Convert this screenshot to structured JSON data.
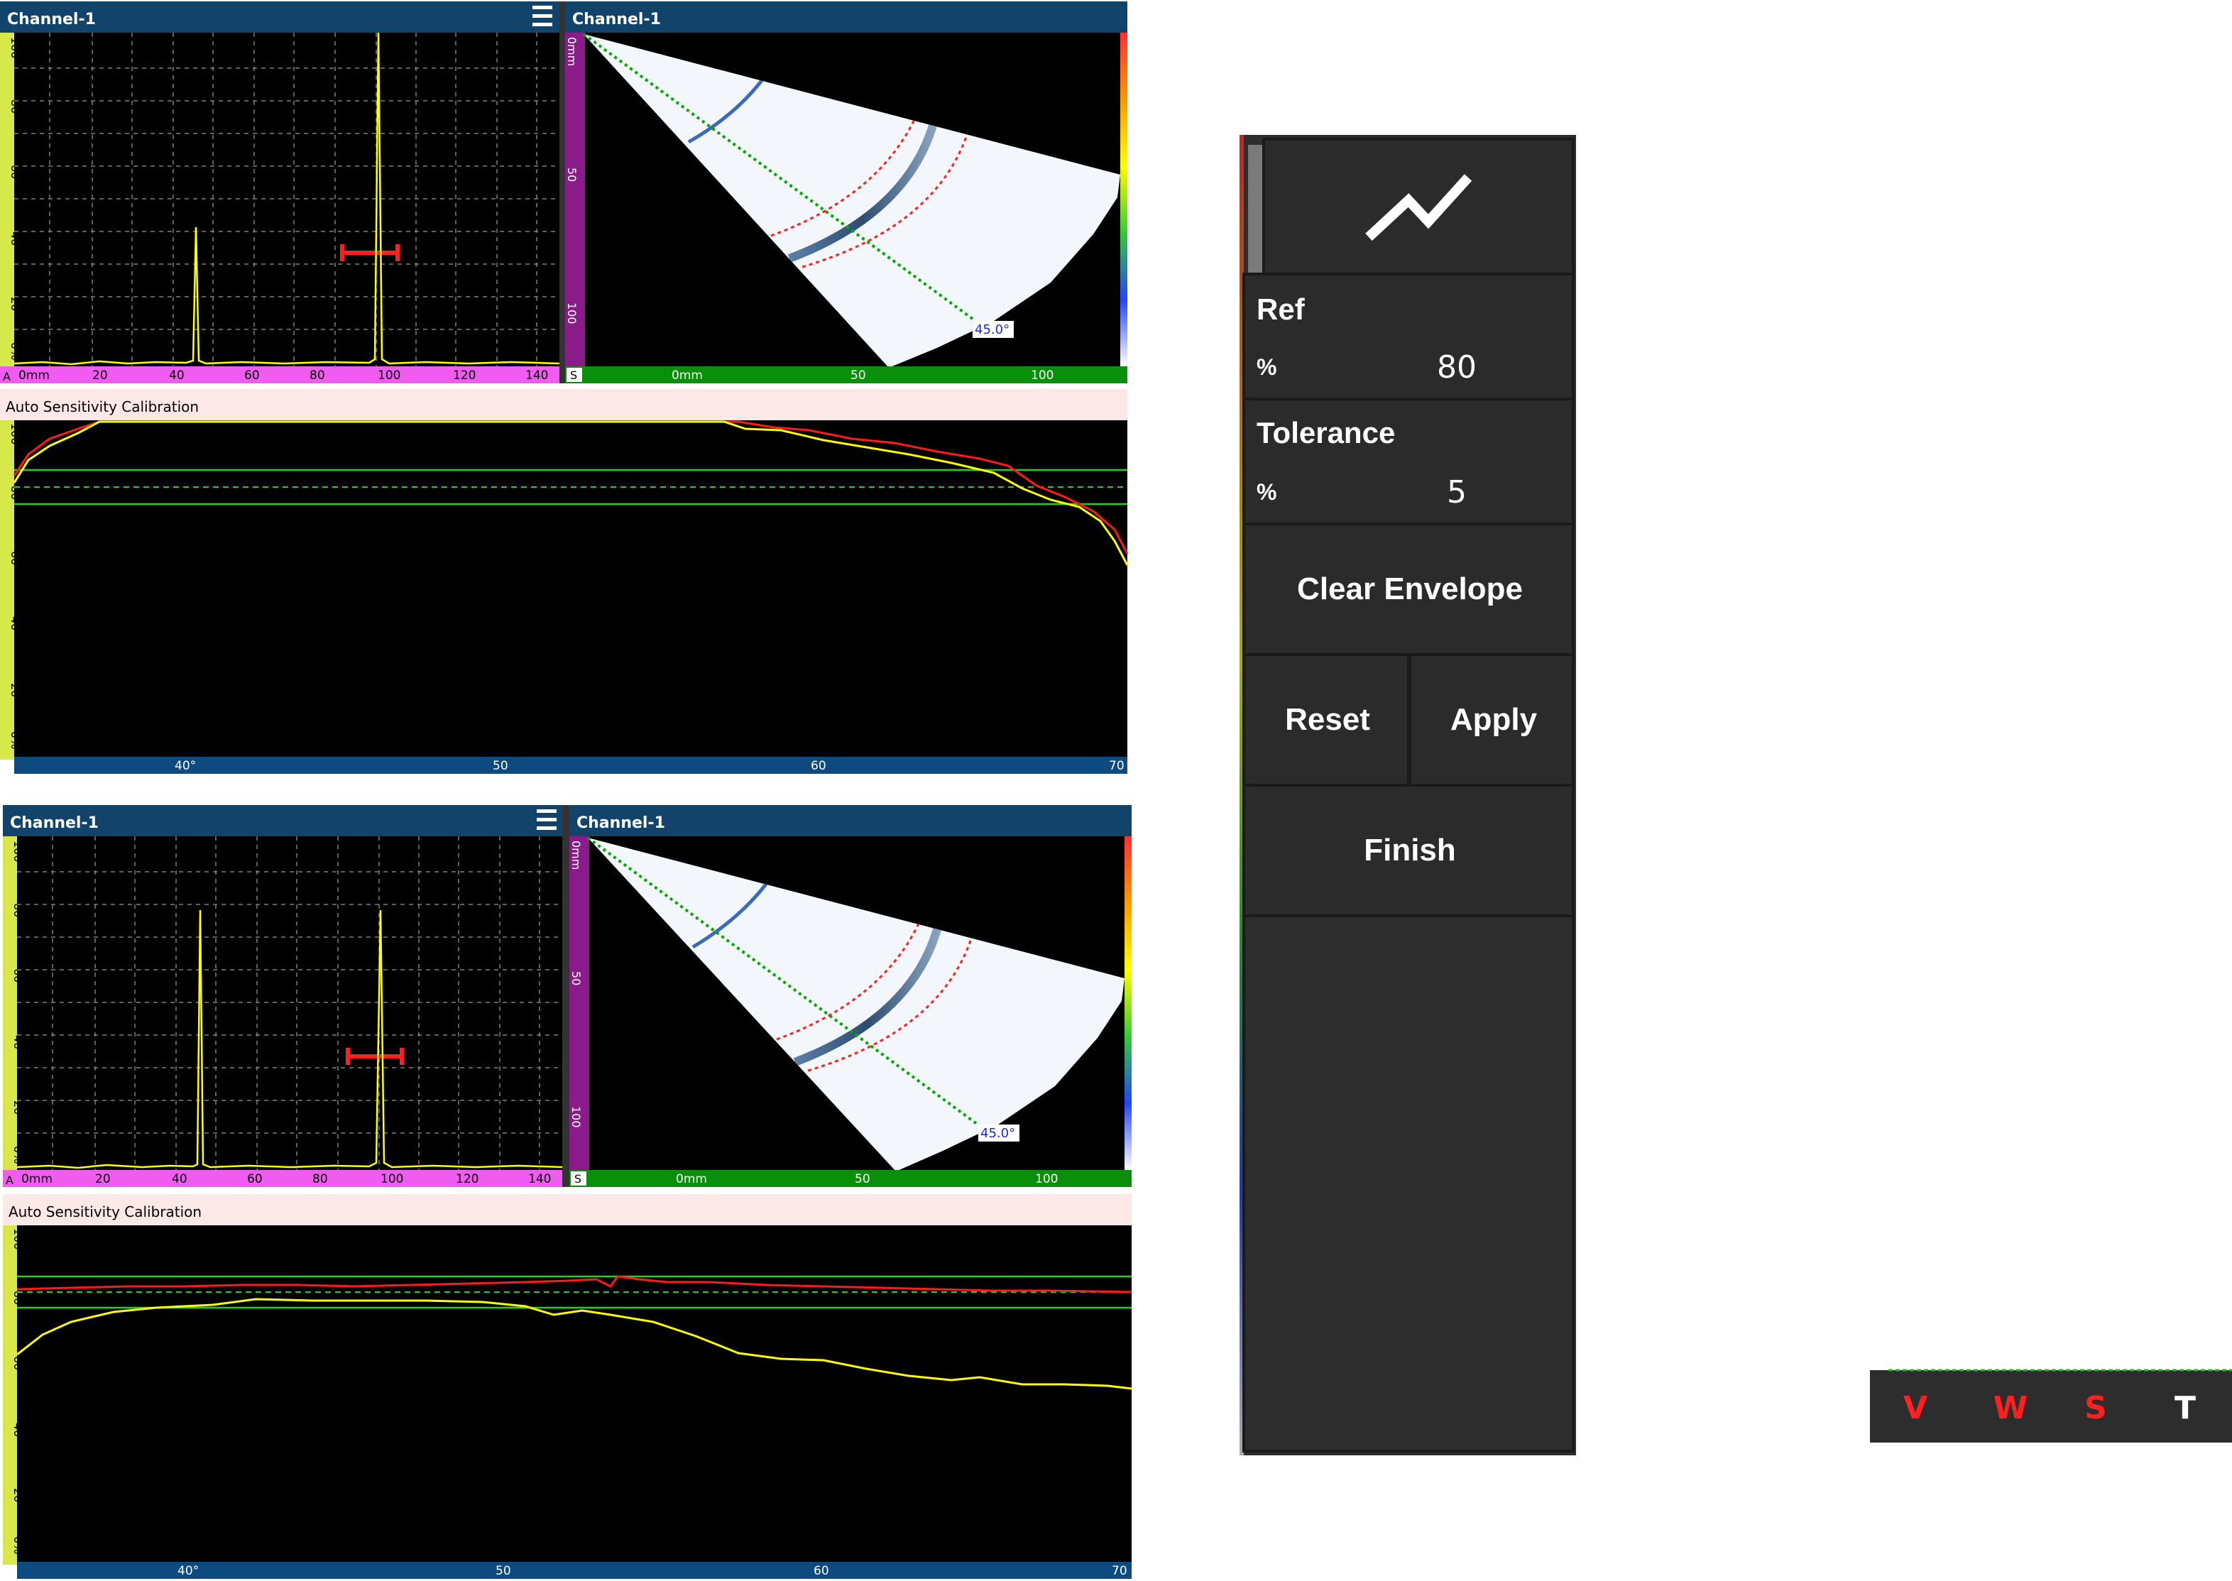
{
  "screens": [
    {
      "ascan": {
        "title": "Channel-1",
        "y_ticks": [
          "100",
          "80",
          "60",
          "40",
          "20",
          "0%"
        ],
        "x_label_letter": "A",
        "x_ticks": [
          "0mm",
          "20",
          "40",
          "60",
          "80",
          "100",
          "120",
          "140"
        ]
      },
      "sscan": {
        "title": "Channel-1",
        "depth_ticks": [
          "0mm",
          "50",
          "100"
        ],
        "x_label_letter": "S",
        "x_ticks": [
          "0mm",
          "50",
          "100"
        ],
        "angle_label": "45.0°"
      },
      "calib": {
        "title": "Auto Sensitivity Calibration",
        "y_ticks": [
          "100",
          "80",
          "60",
          "40",
          "20",
          "0%"
        ],
        "x_ticks": [
          "40°",
          "50",
          "60",
          "70"
        ]
      }
    },
    {
      "ascan": {
        "title": "Channel-1",
        "y_ticks": [
          "100",
          "80",
          "60",
          "40",
          "20",
          "0%"
        ],
        "x_label_letter": "A",
        "x_ticks": [
          "0mm",
          "20",
          "40",
          "60",
          "80",
          "100",
          "120",
          "140"
        ]
      },
      "sscan": {
        "title": "Channel-1",
        "depth_ticks": [
          "0mm",
          "50",
          "100"
        ],
        "x_label_letter": "S",
        "x_ticks": [
          "0mm",
          "50",
          "100"
        ],
        "angle_label": "45.0°"
      },
      "calib": {
        "title": "Auto Sensitivity Calibration",
        "y_ticks": [
          "100",
          "80",
          "60",
          "40",
          "20",
          "0%"
        ],
        "x_ticks": [
          "40°",
          "50",
          "60",
          "70"
        ]
      }
    }
  ],
  "panel": {
    "icon": "envelope-chart-icon",
    "ref": {
      "label": "Ref",
      "unit": "%",
      "value": "80"
    },
    "tolerance": {
      "label": "Tolerance",
      "unit": "%",
      "value": "5"
    },
    "clear_envelope": "Clear Envelope",
    "reset": "Reset",
    "apply": "Apply",
    "finish": "Finish"
  },
  "status_bar": {
    "v": "V",
    "w": "W",
    "s": "S",
    "t": "T"
  },
  "colors": {
    "header_blue": "#12436b",
    "panel_bg": "#2d2d2d",
    "signal": "#ffff00",
    "envelope": "#ff0000",
    "gate": "#ff2020",
    "beam_line": "#00aa00",
    "status_red": "#ff2020"
  }
}
